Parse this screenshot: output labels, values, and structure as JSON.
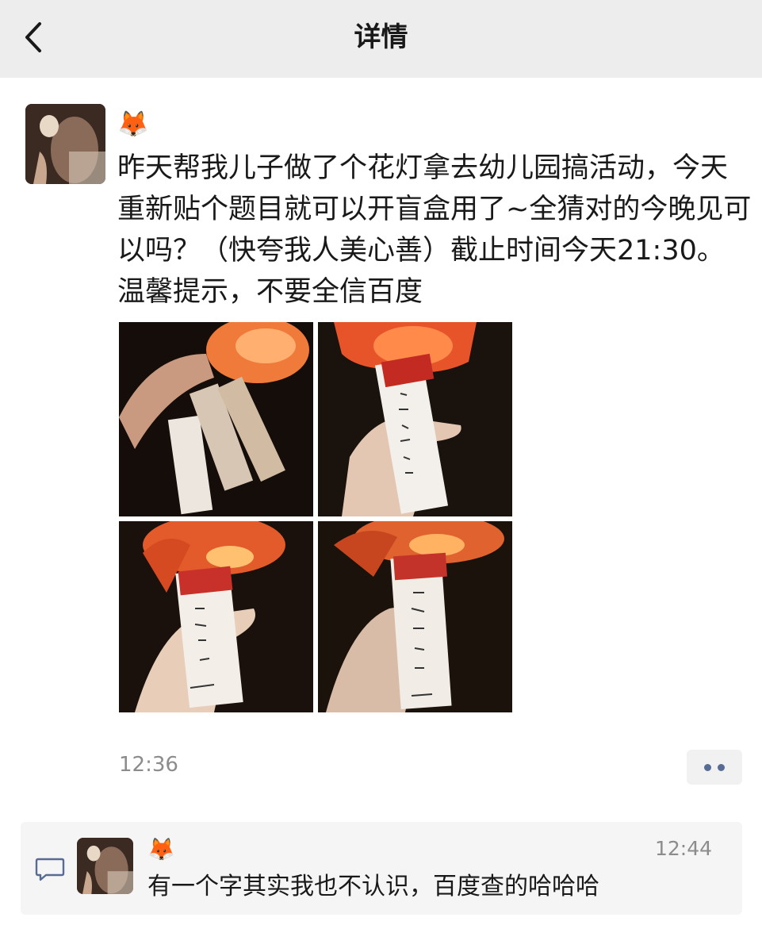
{
  "header": {
    "title": "详情",
    "back_icon": "chevron-left-icon"
  },
  "post": {
    "nickname": "🦊",
    "text": "昨天帮我儿子做了个花灯拿去幼儿园搞活动，今天重新贴个题目就可以开盲盒用了~全猜对的今晚见可以吗？（快夸我人美心善）截止时间今天21:30。温馨提示，不要全信百度",
    "time": "12:36",
    "photos": [
      {
        "name": "lantern-photo-1"
      },
      {
        "name": "lantern-photo-2"
      },
      {
        "name": "lantern-photo-3"
      },
      {
        "name": "lantern-photo-4"
      }
    ],
    "more_icon": "more-dots-icon",
    "accent_color": "#576b95"
  },
  "comment": {
    "icon": "comment-icon",
    "nickname": "🦊",
    "time": "12:44",
    "text": "有一个字其实我也不认识，百度查的哈哈哈"
  }
}
